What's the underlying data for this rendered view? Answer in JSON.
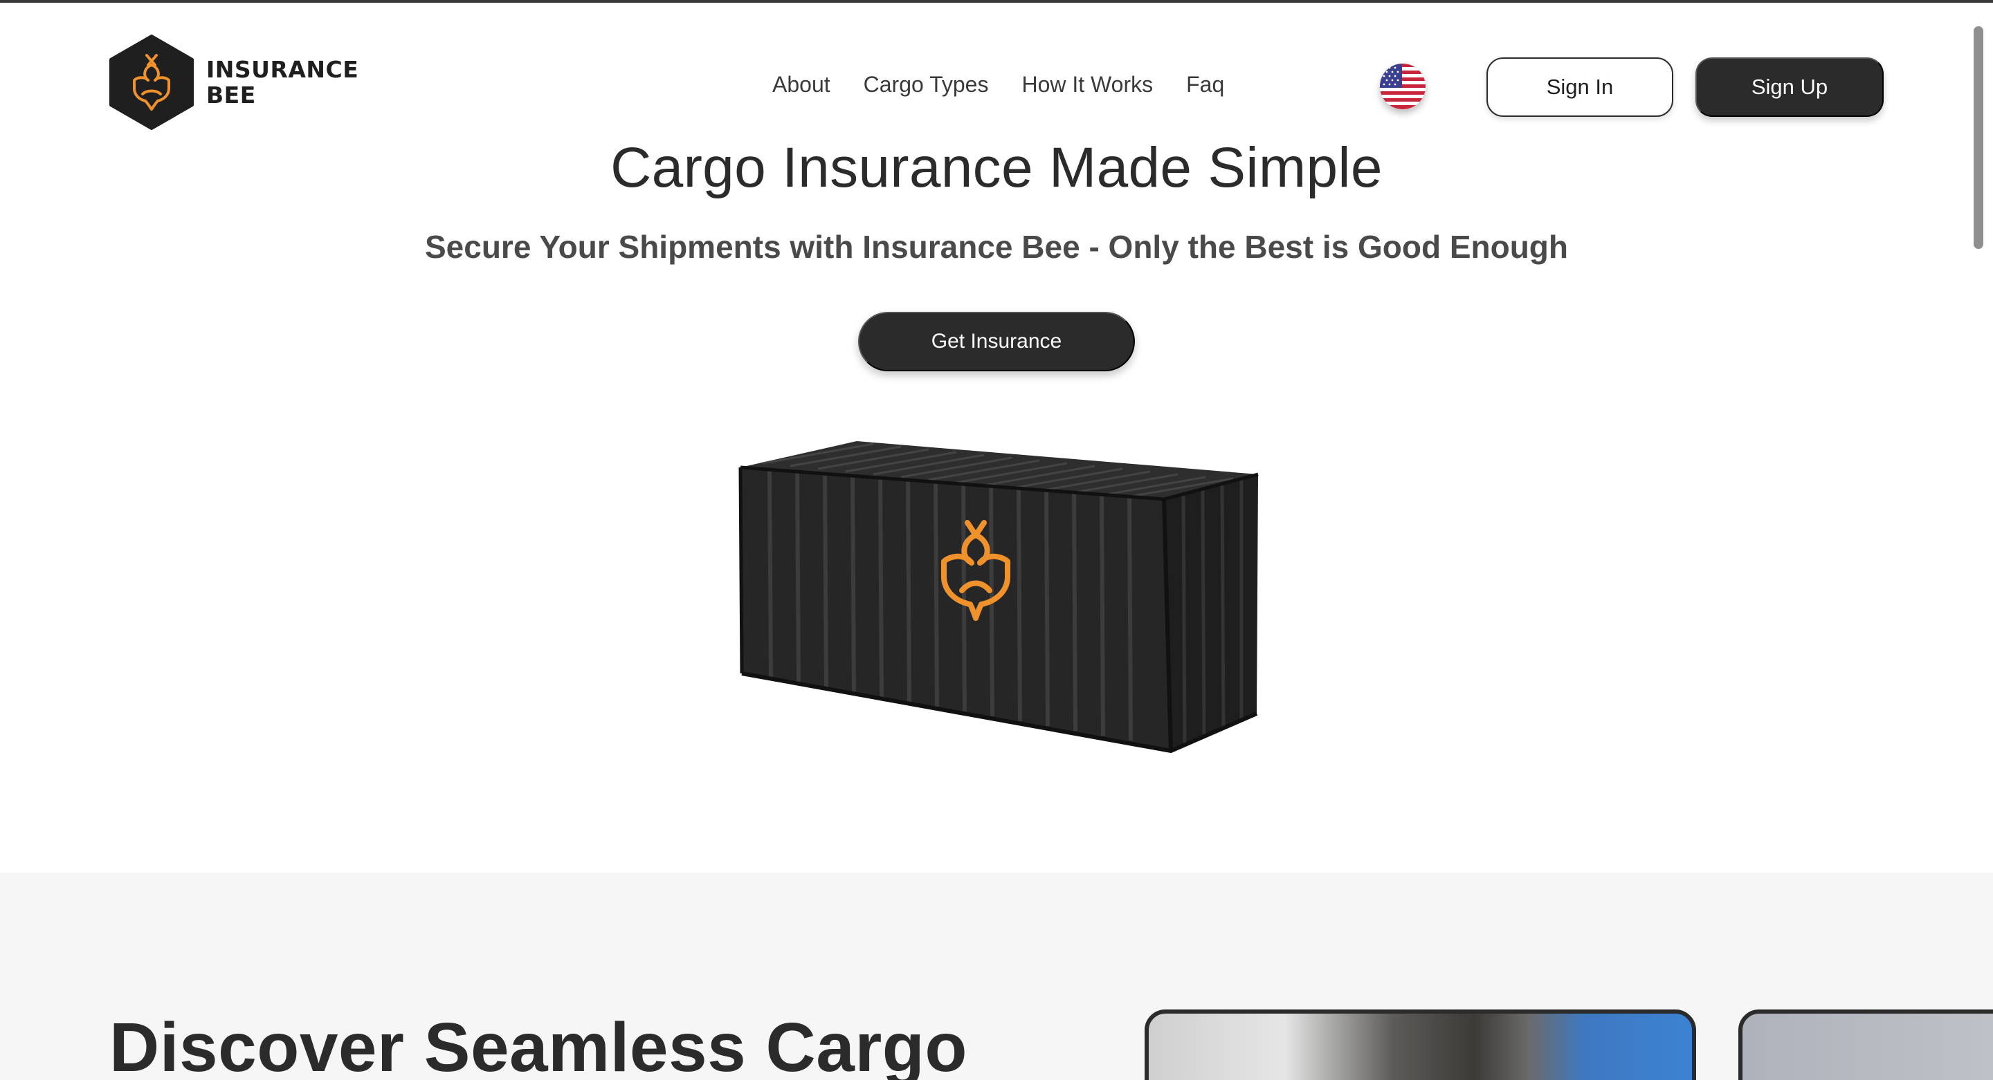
{
  "brand": {
    "name_line1": "INSURANCE",
    "name_line2": "BEE",
    "accent_color": "#f0922b",
    "dark_color": "#2b2b2b"
  },
  "nav": {
    "items": [
      {
        "label": "About"
      },
      {
        "label": "Cargo Types"
      },
      {
        "label": "How It Works"
      },
      {
        "label": "Faq"
      }
    ]
  },
  "language": {
    "icon": "us-flag-icon"
  },
  "auth": {
    "sign_in_label": "Sign In",
    "sign_up_label": "Sign Up"
  },
  "hero": {
    "title": "Cargo Insurance Made Simple",
    "subtitle": "Secure Your Shipments with Insurance Bee - Only the Best is Good Enough",
    "cta_label": "Get Insurance",
    "image": "shipping-container-with-bee-logo"
  },
  "section2": {
    "heading": "Discover Seamless Cargo"
  }
}
